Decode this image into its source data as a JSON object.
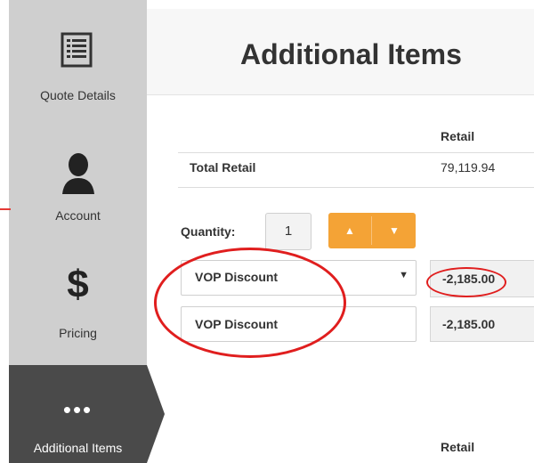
{
  "sidebar": {
    "items": [
      {
        "label": "Quote Details",
        "icon": "list-document-icon"
      },
      {
        "label": "Account",
        "icon": "person-icon"
      },
      {
        "label": "Pricing",
        "icon": "dollar-icon",
        "glyph": "$"
      },
      {
        "label": "Additional Items",
        "icon": "more-icon",
        "glyph": "•••",
        "active": true
      }
    ]
  },
  "header": {
    "title": "Additional Items"
  },
  "table1": {
    "column_header": "Retail",
    "total_label": "Total Retail",
    "total_value": "79,119.94"
  },
  "quantity": {
    "label": "Quantity:",
    "value": "1",
    "up_glyph": "▲",
    "down_glyph": "▼"
  },
  "discount": {
    "select_value": "VOP Discount",
    "select_caret": "▼",
    "amount_input": "-2,185.00",
    "name_field": "VOP Discount",
    "amount_readonly": "-2,185.00"
  },
  "table2": {
    "column_header": "Retail"
  },
  "colors": {
    "accent_orange": "#f4a336",
    "sidebar_bg": "#cfcfcf",
    "active_bg": "#4a4a4a",
    "annotation_red": "#e01e1e"
  }
}
